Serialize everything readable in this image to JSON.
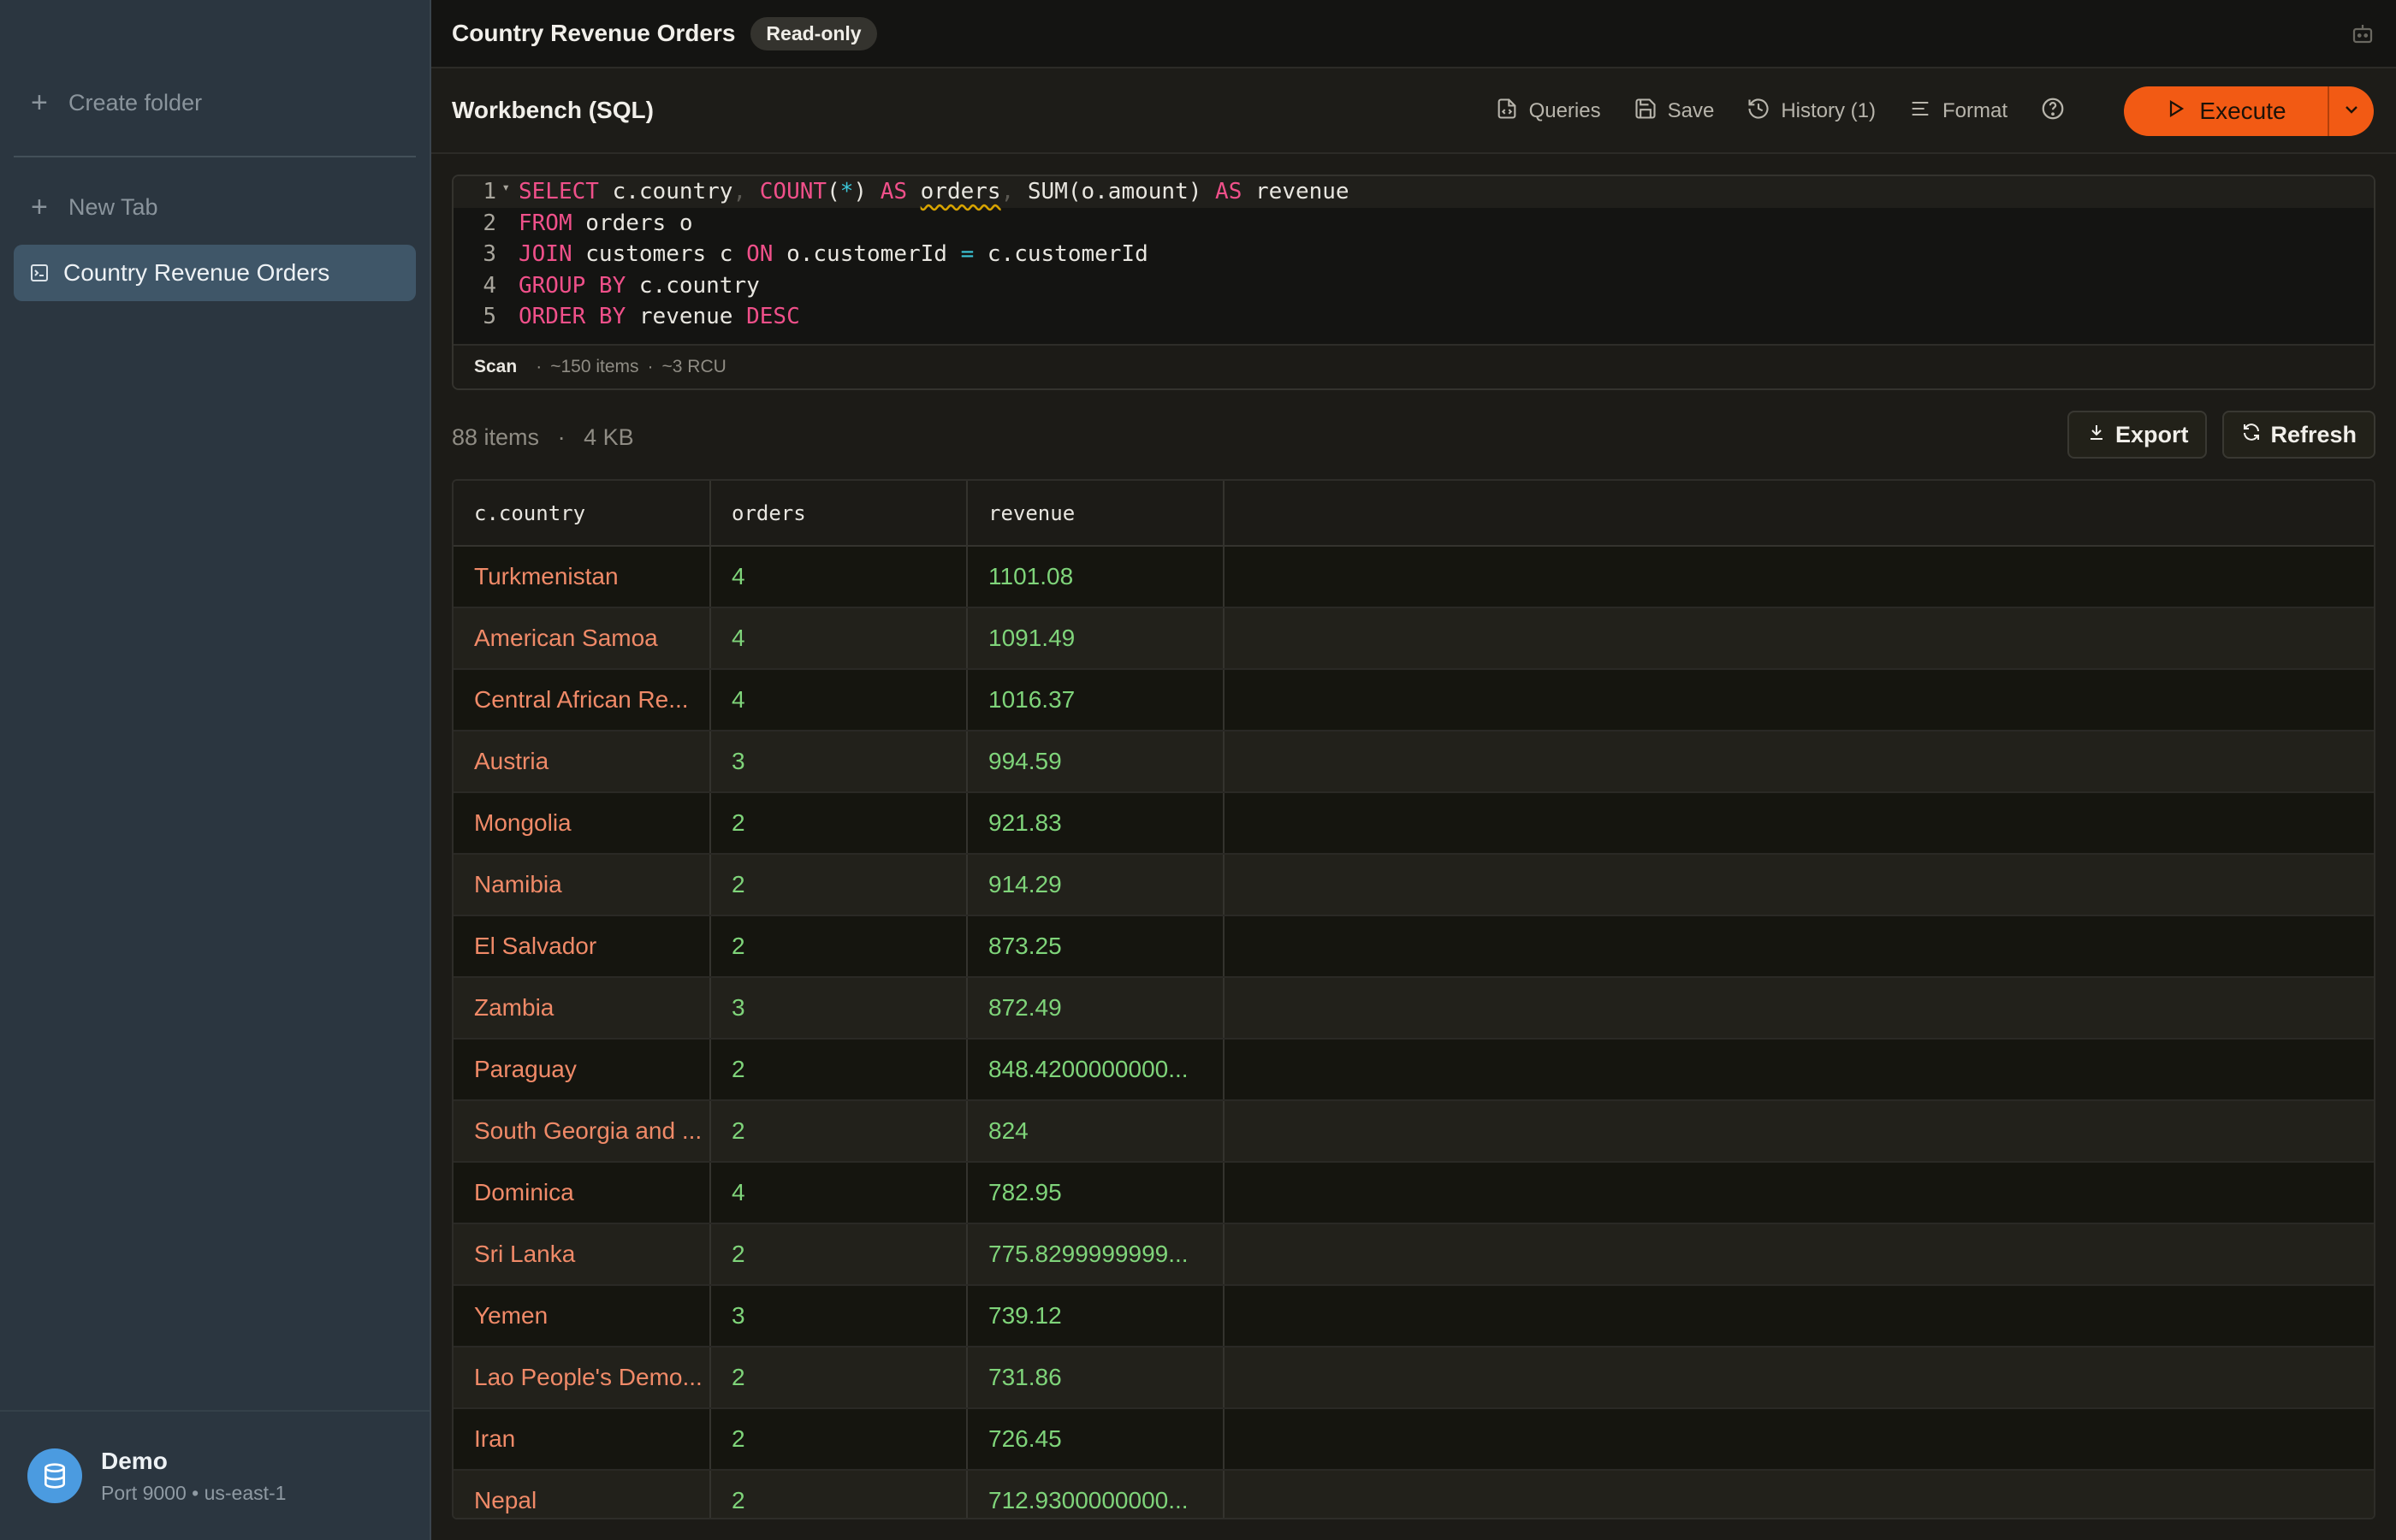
{
  "sidebar": {
    "create_folder": "Create folder",
    "new_tab": "New Tab",
    "active_item": "Country Revenue Orders",
    "footer": {
      "name": "Demo",
      "subtitle": "Port 9000 • us-east-1"
    }
  },
  "topbar": {
    "title": "Country Revenue Orders",
    "badge": "Read-only"
  },
  "toolbar": {
    "title": "Workbench (SQL)",
    "queries": "Queries",
    "save": "Save",
    "history": "History (1)",
    "format": "Format",
    "execute": "Execute"
  },
  "editor": {
    "line_numbers": [
      "1",
      "2",
      "3",
      "4",
      "5"
    ],
    "status": {
      "mode": "Scan",
      "items": "~150 items",
      "rcu": "~3 RCU"
    }
  },
  "results": {
    "count": "88 items",
    "size": "4 KB",
    "export": "Export",
    "refresh": "Refresh",
    "columns": [
      "c.country",
      "orders",
      "revenue"
    ],
    "rows": [
      [
        "Turkmenistan",
        "4",
        "1101.08"
      ],
      [
        "American Samoa",
        "4",
        "1091.49"
      ],
      [
        "Central African Re...",
        "4",
        "1016.37"
      ],
      [
        "Austria",
        "3",
        "994.59"
      ],
      [
        "Mongolia",
        "2",
        "921.83"
      ],
      [
        "Namibia",
        "2",
        "914.29"
      ],
      [
        "El Salvador",
        "2",
        "873.25"
      ],
      [
        "Zambia",
        "3",
        "872.49"
      ],
      [
        "Paraguay",
        "2",
        "848.4200000000..."
      ],
      [
        "South Georgia and ...",
        "2",
        "824"
      ],
      [
        "Dominica",
        "4",
        "782.95"
      ],
      [
        "Sri Lanka",
        "2",
        "775.8299999999..."
      ],
      [
        "Yemen",
        "3",
        "739.12"
      ],
      [
        "Lao People's Demo...",
        "2",
        "731.86"
      ],
      [
        "Iran",
        "2",
        "726.45"
      ],
      [
        "Nepal",
        "2",
        "712.9300000000..."
      ]
    ]
  },
  "colors": {
    "accent": "#f25a14",
    "sidebar_bg": "#2b3640",
    "country_text": "#f08a68",
    "number_text": "#7fd47a",
    "keyword": "#f0508a"
  },
  "icons": [
    "plus-icon",
    "terminal-icon",
    "database-icon",
    "bot-icon",
    "file-code-icon",
    "save-icon",
    "history-icon",
    "format-icon",
    "help-icon",
    "play-icon",
    "chevron-down-icon",
    "download-icon",
    "refresh-icon"
  ]
}
